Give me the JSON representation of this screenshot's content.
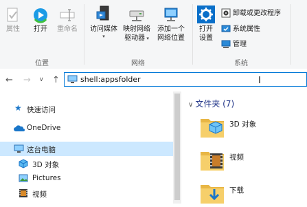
{
  "ribbon": {
    "groups": [
      {
        "label": "位置"
      },
      {
        "label": "网络"
      },
      {
        "label": "系统"
      }
    ],
    "buttons": {
      "properties": "属性",
      "open": "打开",
      "rename": "重命名",
      "access_media": "访问媒体",
      "map_drive_line1": "映射网络",
      "map_drive_line2": "驱动器",
      "add_location_line1": "添加一个",
      "add_location_line2": "网络位置",
      "open_settings_line1": "打开",
      "open_settings_line2": "设置",
      "uninstall": "卸载或更改程序",
      "system_properties": "系统属性",
      "manage": "管理"
    }
  },
  "address": {
    "value": "shell:appsfolder"
  },
  "nav": {
    "items": [
      {
        "label": "快速访问",
        "icon": "star-icon"
      },
      {
        "label": "OneDrive",
        "icon": "cloud-icon"
      },
      {
        "label": "这台电脑",
        "icon": "computer-icon",
        "selected": true
      },
      {
        "label": "3D 对象",
        "icon": "3d-objects-icon"
      },
      {
        "label": "Pictures",
        "icon": "pictures-icon"
      },
      {
        "label": "视频",
        "icon": "video-icon"
      }
    ]
  },
  "content": {
    "section_title": "文件夹 (7)",
    "folders": [
      {
        "label": "3D 对象",
        "icon": "3d-folder-icon"
      },
      {
        "label": "视频",
        "icon": "video-folder-icon"
      },
      {
        "label": "下载",
        "icon": "download-folder-icon"
      }
    ]
  },
  "colors": {
    "accent": "#0078d7",
    "selection": "#cce8ff",
    "section_title": "#1e3287"
  }
}
